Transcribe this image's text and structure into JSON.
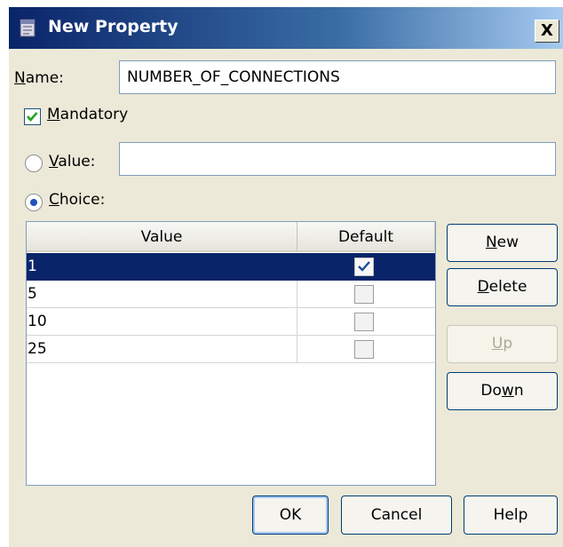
{
  "window": {
    "title": "New Property",
    "close_glyph": "X"
  },
  "name_field": {
    "label_mnemonic": "N",
    "label_rest": "ame:",
    "value": "NUMBER_OF_CONNECTIONS"
  },
  "mandatory": {
    "label_mnemonic": "M",
    "label_rest": "andatory",
    "checked": true
  },
  "value_option": {
    "label_mnemonic": "V",
    "label_rest": "alue:",
    "selected": false,
    "value": ""
  },
  "choice_option": {
    "label_mnemonic": "C",
    "label_rest": "hoice:",
    "selected": true
  },
  "choices_table": {
    "columns": [
      "Value",
      "Default"
    ],
    "rows": [
      {
        "value": "1",
        "default": true,
        "selected": true
      },
      {
        "value": "5",
        "default": false,
        "selected": false
      },
      {
        "value": "10",
        "default": false,
        "selected": false
      },
      {
        "value": "25",
        "default": false,
        "selected": false
      }
    ]
  },
  "side_buttons": {
    "new": {
      "mnemonic": "N",
      "rest": "ew"
    },
    "delete": {
      "mnemonic": "D",
      "rest": "elete"
    },
    "up": {
      "mnemonic": "U",
      "rest": "p",
      "disabled": true
    },
    "down": {
      "pre": "Do",
      "mnemonic": "w",
      "rest": "n"
    }
  },
  "footer_buttons": {
    "ok": "OK",
    "cancel": "Cancel",
    "help": "Help"
  },
  "icons": {
    "title": "property-app-icon",
    "check": "checkmark-icon"
  },
  "colors": {
    "title_gradient_start": "#0a246a",
    "dialog_background": "#ece9d8",
    "selection": "#0a246a"
  }
}
